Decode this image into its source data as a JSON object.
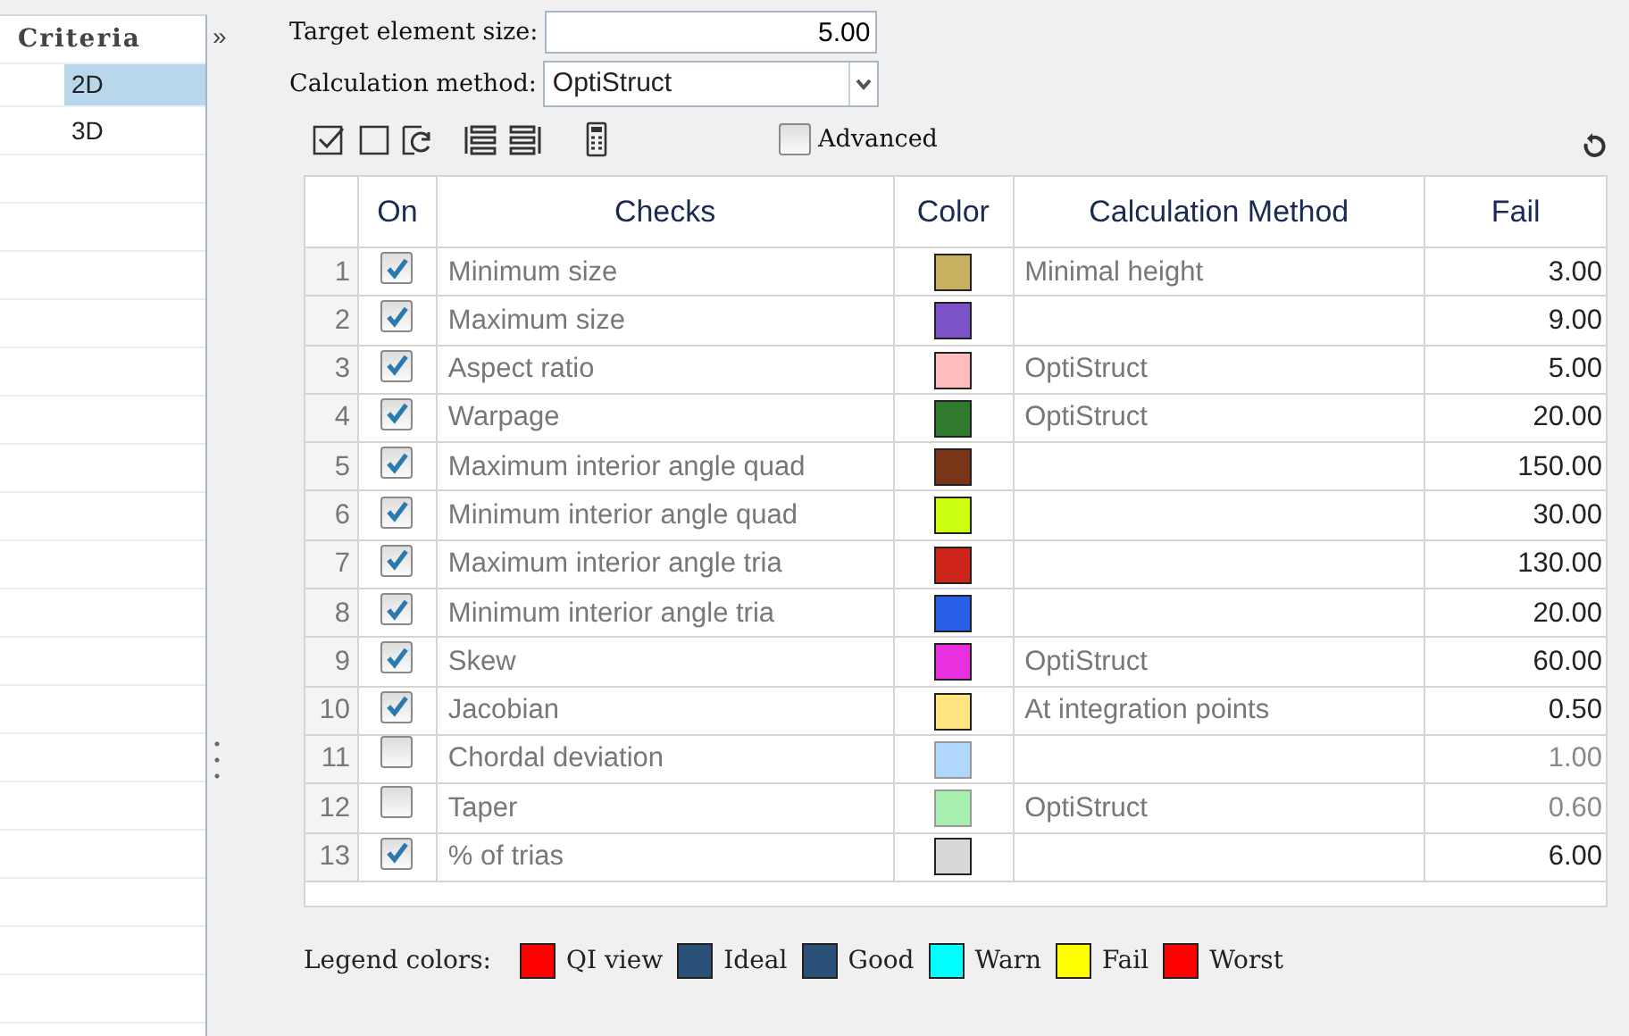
{
  "sidebar": {
    "title": "Criteria",
    "collapse": "»",
    "items": [
      {
        "label": "2D",
        "selected": true
      },
      {
        "label": "3D",
        "selected": false
      }
    ]
  },
  "target_size": {
    "label": "Target element size:",
    "value": "5.00"
  },
  "calc_method": {
    "label": "Calculation method:",
    "value": "OptiStruct"
  },
  "advanced": {
    "label": "Advanced",
    "checked": false
  },
  "table": {
    "columns": [
      "On",
      "Checks",
      "Color",
      "Calculation Method",
      "Fail"
    ],
    "rows": [
      {
        "index": "1",
        "on": true,
        "check": "Minimum size",
        "color": "#c8b060",
        "method": "Minimal height",
        "fail": "3.00"
      },
      {
        "index": "2",
        "on": true,
        "check": "Maximum size",
        "color": "#7b52c8",
        "method": "",
        "fail": "9.00"
      },
      {
        "index": "3",
        "on": true,
        "check": "Aspect ratio",
        "color": "#ffbcbc",
        "method": "OptiStruct",
        "fail": "5.00"
      },
      {
        "index": "4",
        "on": true,
        "check": "Warpage",
        "color": "#2e7a2e",
        "method": "OptiStruct",
        "fail": "20.00"
      },
      {
        "index": "5",
        "on": true,
        "check": "Maximum interior angle quad",
        "color": "#7a3418",
        "method": "",
        "fail": "150.00"
      },
      {
        "index": "6",
        "on": true,
        "check": "Minimum interior angle quad",
        "color": "#ccff10",
        "method": "",
        "fail": "30.00"
      },
      {
        "index": "7",
        "on": true,
        "check": "Maximum interior angle tria",
        "color": "#cc2418",
        "method": "",
        "fail": "130.00"
      },
      {
        "index": "8",
        "on": true,
        "check": "Minimum interior angle tria",
        "color": "#2860e8",
        "method": "",
        "fail": "20.00"
      },
      {
        "index": "9",
        "on": true,
        "check": "Skew",
        "color": "#e830e0",
        "method": "OptiStruct",
        "fail": "60.00"
      },
      {
        "index": "10",
        "on": true,
        "check": "Jacobian",
        "color": "#ffe480",
        "method": "At integration points",
        "fail": "0.50"
      },
      {
        "index": "11",
        "on": false,
        "check": "Chordal deviation",
        "color": "#b0d8ff",
        "method": "",
        "fail": "1.00"
      },
      {
        "index": "12",
        "on": false,
        "check": "Taper",
        "color": "#a8f0b0",
        "method": "OptiStruct",
        "fail": "0.60"
      },
      {
        "index": "13",
        "on": true,
        "check": "% of trias",
        "color": "#d8d8d8",
        "method": "",
        "fail": "6.00"
      }
    ]
  },
  "legend": {
    "label": "Legend colors:",
    "items": [
      {
        "label": "QI view",
        "color": "#ff0000"
      },
      {
        "label": "Ideal",
        "color": "#2a5078"
      },
      {
        "label": "Good",
        "color": "#2a5078"
      },
      {
        "label": "Warn",
        "color": "#00ffff"
      },
      {
        "label": "Fail",
        "color": "#ffff00"
      },
      {
        "label": "Worst",
        "color": "#ff0000"
      }
    ]
  }
}
